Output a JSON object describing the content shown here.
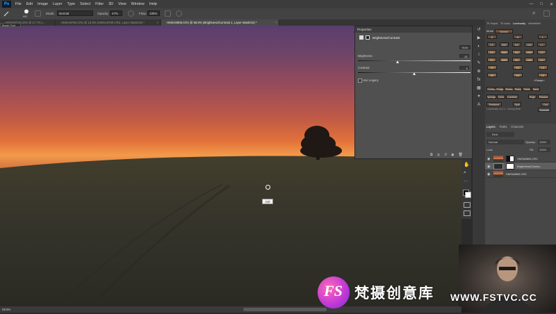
{
  "app": {
    "logo": "Ps"
  },
  "menubar": {
    "items": [
      "File",
      "Edit",
      "Image",
      "Layer",
      "Type",
      "Select",
      "Filter",
      "3D",
      "View",
      "Window",
      "Help"
    ],
    "window_controls": [
      "—",
      "□",
      "✕"
    ]
  },
  "options": {
    "brush_size": "600",
    "mode_label": "Mode:",
    "mode_value": "Normal",
    "opacity_label": "Opacity:",
    "opacity_value": "47%",
    "flow_label": "Flow:",
    "flow_value": "100%"
  },
  "tool_flyout": "Brush Tool",
  "tabs": [
    {
      "label": "HMSA8729.CR2 @ 17.7% (...",
      "active": false
    },
    {
      "label": "HMSA8760.CR2 @ 13.9% (HMSA8760.CR2, Layer Mask/16) *",
      "active": false
    },
    {
      "label": "HMSA8806.CR2 @ 58.8% (Brightness/Contrast 1, Layer Mask/16) *",
      "active": true
    }
  ],
  "properties": {
    "title": "Properties",
    "adjustment": "Brightness/Contrast",
    "auto": "Auto",
    "brightness_label": "Brightness:",
    "brightness_value": "-41",
    "contrast_label": "Contrast:",
    "contrast_value": "0",
    "use_legacy": "Use Legacy"
  },
  "luminosity": {
    "tabs": [
      "TK Rapid",
      "TK Actio",
      "Luminosity",
      "InfiniteMet"
    ],
    "mode_label": "Mode",
    "mode_value": "Normal",
    "rows": [
      [
        "D",
        "M",
        "L"
      ],
      [
        "D2",
        "DM2",
        "M2",
        "LM2",
        "L2"
      ],
      [
        "D3",
        "DM3",
        "M3",
        "LM3",
        "L3"
      ],
      [
        "D4",
        "DM4",
        "M4",
        "LM4",
        "L4"
      ],
      [
        "D5",
        "M5",
        "L5"
      ],
      [
        "D6",
        "M6",
        "L6"
      ]
    ],
    "bottom_buttons": [
      "Contrast",
      "Dodge",
      "Reveal",
      "Sharp",
      "Pixels",
      "Save"
    ],
    "row2_buttons": [
      "Sponge",
      "Color",
      "Combine",
      "Edge",
      "Shadow"
    ],
    "row3_buttons": [
      "Preblend",
      "Split",
      "Ord"
    ],
    "status": "Luminosity v4.0.1 - Sheng Bolei",
    "tutorials": "Tutorials",
    "range": "<Range>"
  },
  "layers_panel": {
    "tabs": [
      "Layers",
      "Paths",
      "Channels"
    ],
    "kind": "Kind",
    "blend": "Normal",
    "opacity_label": "Opacity:",
    "opacity_value": "100%",
    "lock_label": "Lock:",
    "fill_label": "Fill:",
    "fill_value": "100%",
    "layers": [
      {
        "name": "HMSA8806.CR2",
        "has_mask": true,
        "selected": false
      },
      {
        "name": "Brightness/Contra...",
        "has_mask": true,
        "selected": true
      },
      {
        "name": "HMSA8806.CR2",
        "has_mask": false,
        "selected": false
      }
    ]
  },
  "status": {
    "zoom": "58.8%"
  },
  "tooltip": "Ctrl",
  "watermark": {
    "logo_text": "FS",
    "text": "梵摄创意库",
    "url": "WWW.FSTVC.CC"
  }
}
